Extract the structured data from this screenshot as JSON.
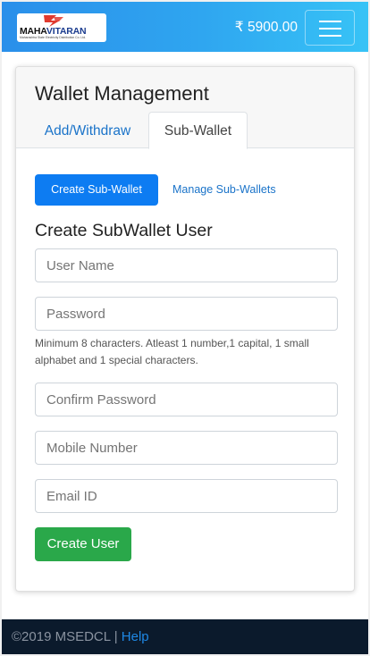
{
  "header": {
    "logo": {
      "brand_part1": "MAHA",
      "brand_part2": "VITARAN",
      "tagline": "Maharashtra State Electricity Distribution Co. Ltd."
    },
    "balance": "₹ 5900.00"
  },
  "card": {
    "title": "Wallet Management",
    "tabs": [
      {
        "label": "Add/Withdraw",
        "active": false
      },
      {
        "label": "Sub-Wallet",
        "active": true
      }
    ]
  },
  "subwallet": {
    "create_button": "Create Sub-Wallet",
    "manage_link": "Manage Sub-Wallets",
    "section_title": "Create SubWallet User"
  },
  "form": {
    "username_placeholder": "User Name",
    "password_placeholder": "Password",
    "password_hint": "Minimum 8 characters. Atleast 1 number,1 capital, 1 small alphabet and 1 special characters.",
    "confirm_password_placeholder": "Confirm Password",
    "mobile_placeholder": "Mobile Number",
    "email_placeholder": "Email ID",
    "submit_label": "Create User"
  },
  "footer": {
    "copyright": "©2019 MSEDCL",
    "separator": " | ",
    "help_link": "Help"
  },
  "colors": {
    "header_gradient_start": "#2a8fea",
    "header_gradient_end": "#37c3f6",
    "primary": "#0d7cf2",
    "success": "#2aa84a",
    "link": "#1a73c9",
    "footer_bg": "#0b1a2c",
    "logo_red": "#e03a2f"
  }
}
